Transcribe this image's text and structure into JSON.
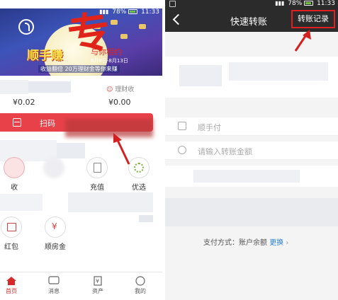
{
  "left": {
    "statusbar": {
      "battery_pct": "78%",
      "time": "11:33"
    },
    "banner": {
      "big_char": "专",
      "headline": "顺手赚",
      "sub_headline": "与你相约",
      "small_text": "8月8日-8月13日",
      "promo_text": "收益翻倍 20万理财金等你来赚"
    },
    "amounts": {
      "left_value": "¥0.02",
      "right_label": "理财收",
      "right_value": "¥0.00"
    },
    "scan": {
      "label": "扫码"
    },
    "grid": [
      {
        "label": "收",
        "icon": "card-icon"
      },
      {
        "label": "",
        "icon": "blurred-icon"
      },
      {
        "label": "充值",
        "icon": "topup-icon"
      },
      {
        "label": "优选",
        "icon": "sun-icon"
      },
      {
        "label": "红包",
        "icon": "red-packet-icon"
      },
      {
        "label": "顺房金",
        "icon": "yen-cart-icon"
      }
    ],
    "tabs": [
      {
        "label": "首页",
        "icon": "home-icon",
        "active": true
      },
      {
        "label": "消息",
        "icon": "message-icon",
        "active": false
      },
      {
        "label": "资产",
        "icon": "asset-icon",
        "active": false
      },
      {
        "label": "我的",
        "icon": "profile-icon",
        "active": false
      }
    ]
  },
  "right": {
    "statusbar": {
      "battery_pct": "78%",
      "time": "11:33"
    },
    "title": "快速转账",
    "record_button": "转账记录",
    "payee_placeholder": "顺手付",
    "amount_placeholder": "请输入转账金额",
    "pay_method_label": "支付方式：账户余额",
    "pay_change": "更换",
    "accent_color": "#e02020"
  }
}
